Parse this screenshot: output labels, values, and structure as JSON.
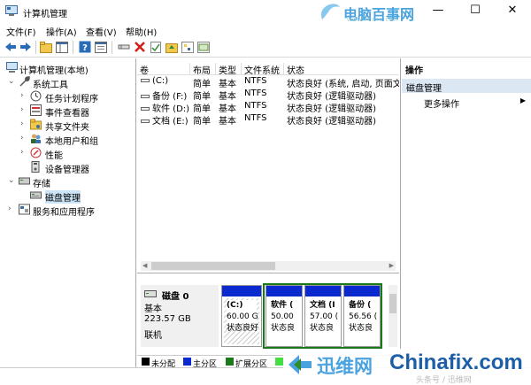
{
  "window": {
    "title": "计算机管理",
    "controls": {
      "minimize": "—",
      "maximize": "☐",
      "close": "✕"
    }
  },
  "watermark_top": {
    "text": "电脑百事网",
    "sub": "WWW.PC841.COM"
  },
  "menu": [
    "文件(F)",
    "操作(A)",
    "查看(V)",
    "帮助(H)"
  ],
  "toolbar": {
    "icons": [
      "back-icon",
      "forward-icon",
      "up-folder-icon",
      "show-tree-icon",
      "help-icon",
      "properties-icon",
      "connect-icon",
      "delete-icon",
      "check-icon",
      "folder-up-icon",
      "search-icon",
      "wizard-icon"
    ]
  },
  "tree": {
    "root": "计算机管理(本地)",
    "system_tools": "系统工具",
    "task_scheduler": "任务计划程序",
    "event_viewer": "事件查看器",
    "shared_folders": "共享文件夹",
    "local_users": "本地用户和组",
    "performance": "性能",
    "device_manager": "设备管理器",
    "storage": "存储",
    "disk_management": "磁盘管理",
    "services": "服务和应用程序"
  },
  "volumes": {
    "columns": [
      "卷",
      "布局",
      "类型",
      "文件系统",
      "状态"
    ],
    "rows": [
      {
        "volume": "(C:)",
        "layout": "简单",
        "type": "基本",
        "fs": "NTFS",
        "status": "状态良好 (系统, 启动, 页面文"
      },
      {
        "volume": "备份 (F:)",
        "layout": "简单",
        "type": "基本",
        "fs": "NTFS",
        "status": "状态良好 (逻辑驱动器)"
      },
      {
        "volume": "软件 (D:)",
        "layout": "简单",
        "type": "基本",
        "fs": "NTFS",
        "status": "状态良好 (逻辑驱动器)"
      },
      {
        "volume": "文档 (E:)",
        "layout": "简单",
        "type": "基本",
        "fs": "NTFS",
        "status": "状态良好 (逻辑驱动器)"
      }
    ]
  },
  "disk": {
    "name": "磁盘 0",
    "type": "基本",
    "size": "223.57 GB",
    "state": "联机",
    "partitions": [
      {
        "name": "(C:)",
        "size": "60.00 G",
        "status": "状态良好",
        "color": "#0a2ad0"
      },
      {
        "name": "软件 (",
        "size": "50.00",
        "status": "状态良",
        "color": "#0a2ad0"
      },
      {
        "name": "文档 (I",
        "size": "57.00 (",
        "status": "状态良",
        "color": "#0a2ad0"
      },
      {
        "name": "备份 (",
        "size": "56.56 (",
        "status": "状态良",
        "color": "#0a2ad0"
      }
    ]
  },
  "legend": [
    {
      "label": "未分配",
      "color": "#000000"
    },
    {
      "label": "主分区",
      "color": "#0a2ad0"
    },
    {
      "label": "扩展分区",
      "color": "#1a7a1a"
    },
    {
      "label": "",
      "color": "#44dd44"
    }
  ],
  "actions": {
    "header": "操作",
    "section": "磁盘管理",
    "more": "更多操作"
  },
  "watermark_bottom": {
    "cn": "迅维网",
    "en": "Chinafix.com",
    "sub": "头条号 / 迅维网"
  }
}
